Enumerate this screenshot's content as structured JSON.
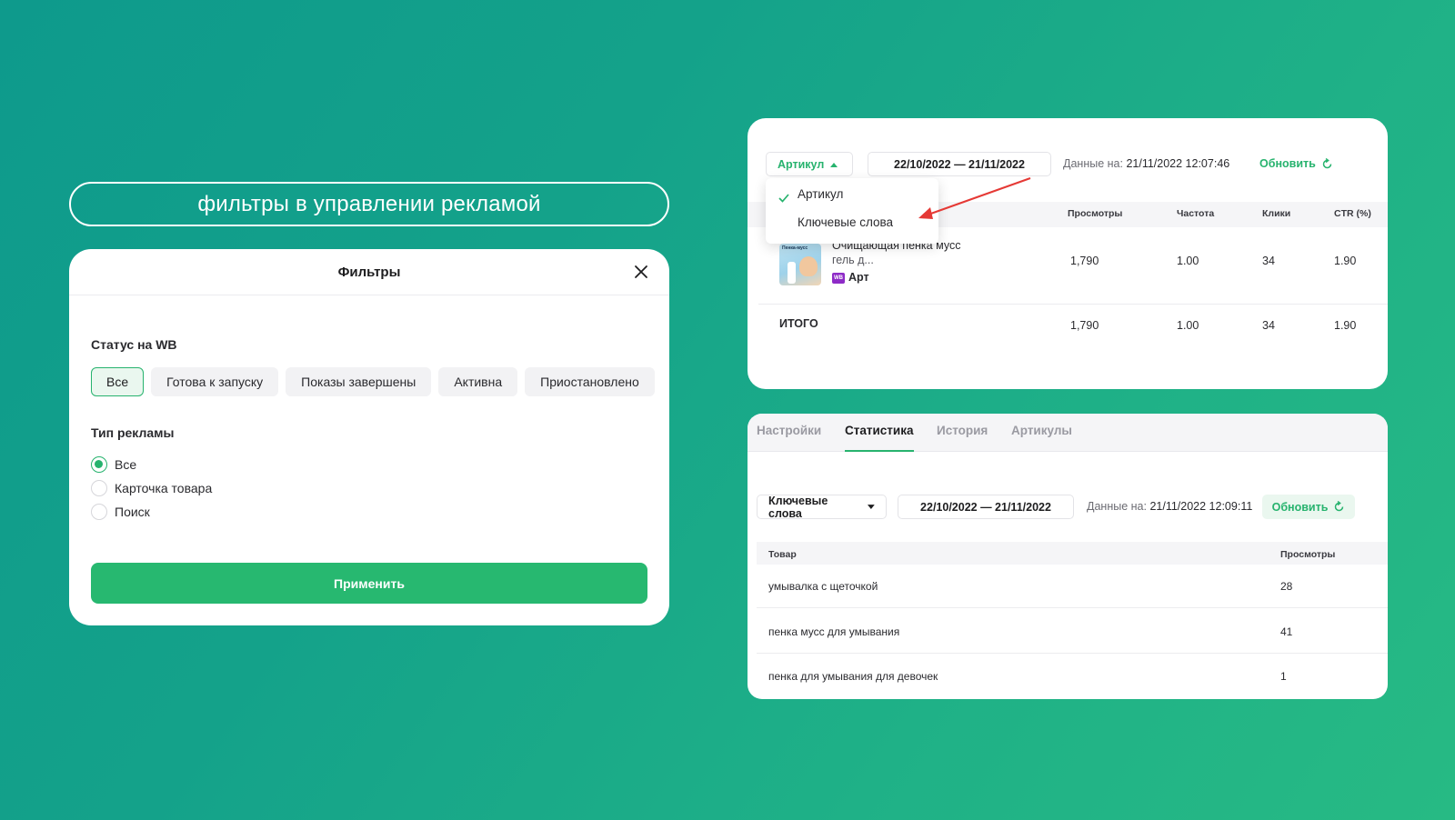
{
  "page": {
    "title": "фильтры в управлении рекламой"
  },
  "filters_modal": {
    "title": "Фильтры",
    "status_label": "Статус на WB",
    "status_chips": [
      "Все",
      "Готова к запуску",
      "Показы завершены",
      "Активна",
      "Приостановлено"
    ],
    "ad_type_label": "Тип рекламы",
    "ad_types": [
      "Все",
      "Карточка товара",
      "Поиск"
    ],
    "selected_ad_type": "Все",
    "apply_label": "Применить"
  },
  "stats_top": {
    "selector": "Артикул",
    "date_range": "22/10/2022 — 21/11/2022",
    "data_on_label": "Данные на:",
    "data_on_value": "21/11/2022 12:07:46",
    "refresh_label": "Обновить",
    "dropdown_items": [
      "Артикул",
      "Ключевые слова"
    ],
    "columns": [
      "Просмотры",
      "Частота",
      "Клики",
      "CTR (%)"
    ],
    "product": {
      "name_line1": "Очищающая пенка мусс",
      "name_line2": "гель д...",
      "badge": "WB",
      "sku_label": "Арт",
      "thumb_text": "Пенка-мусс",
      "values": [
        "1,790",
        "1.00",
        "34",
        "1.90"
      ]
    },
    "total": {
      "label": "ИТОГО",
      "values": [
        "1,790",
        "1.00",
        "34",
        "1.90"
      ]
    }
  },
  "stats_bottom": {
    "tabs": [
      "Настройки",
      "Статистика",
      "История",
      "Артикулы"
    ],
    "active_tab": "Статистика",
    "selector": "Ключевые слова",
    "date_range": "22/10/2022 — 21/11/2022",
    "data_on_label": "Данные на:",
    "data_on_value": "21/11/2022 12:09:11",
    "refresh_label": "Обновить",
    "columns": [
      "Товар",
      "Просмотры"
    ],
    "rows": [
      {
        "query": "умывалка с щеточкой",
        "views": "28"
      },
      {
        "query": "пенка мусс для умывания",
        "views": "41"
      },
      {
        "query": "пенка для умывания для девочек",
        "views": "1"
      }
    ]
  },
  "colors": {
    "accent": "#27b36e",
    "arrow": "#e53935",
    "background_start": "#0e9a8c",
    "background_end": "#27ba84"
  }
}
